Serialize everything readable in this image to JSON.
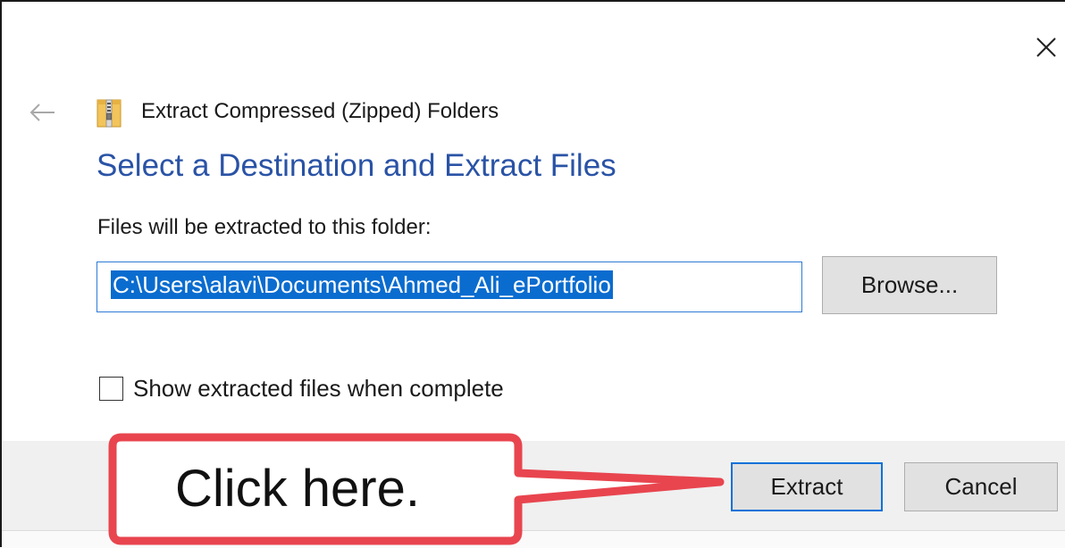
{
  "dialog": {
    "wizard_title": "Extract Compressed (Zipped) Folders",
    "heading": "Select a Destination and Extract Files",
    "destination_label": "Files will be extracted to this folder:",
    "destination_path": "C:\\Users\\alavi\\Documents\\Ahmed_Ali_ePortfolio",
    "browse_label": "Browse...",
    "show_files_label": "Show extracted files when complete",
    "show_files_checked": false
  },
  "footer": {
    "extract_label": "Extract",
    "cancel_label": "Cancel"
  },
  "callout": {
    "text": "Click here.",
    "border_color": "#e8454f"
  },
  "colors": {
    "heading": "#2a53a6",
    "selection": "#0a6ccf",
    "focus_border": "#0a72d8"
  },
  "icons": {
    "close": "close-icon",
    "back": "back-arrow-icon",
    "zip_folder": "zip-folder-icon"
  }
}
